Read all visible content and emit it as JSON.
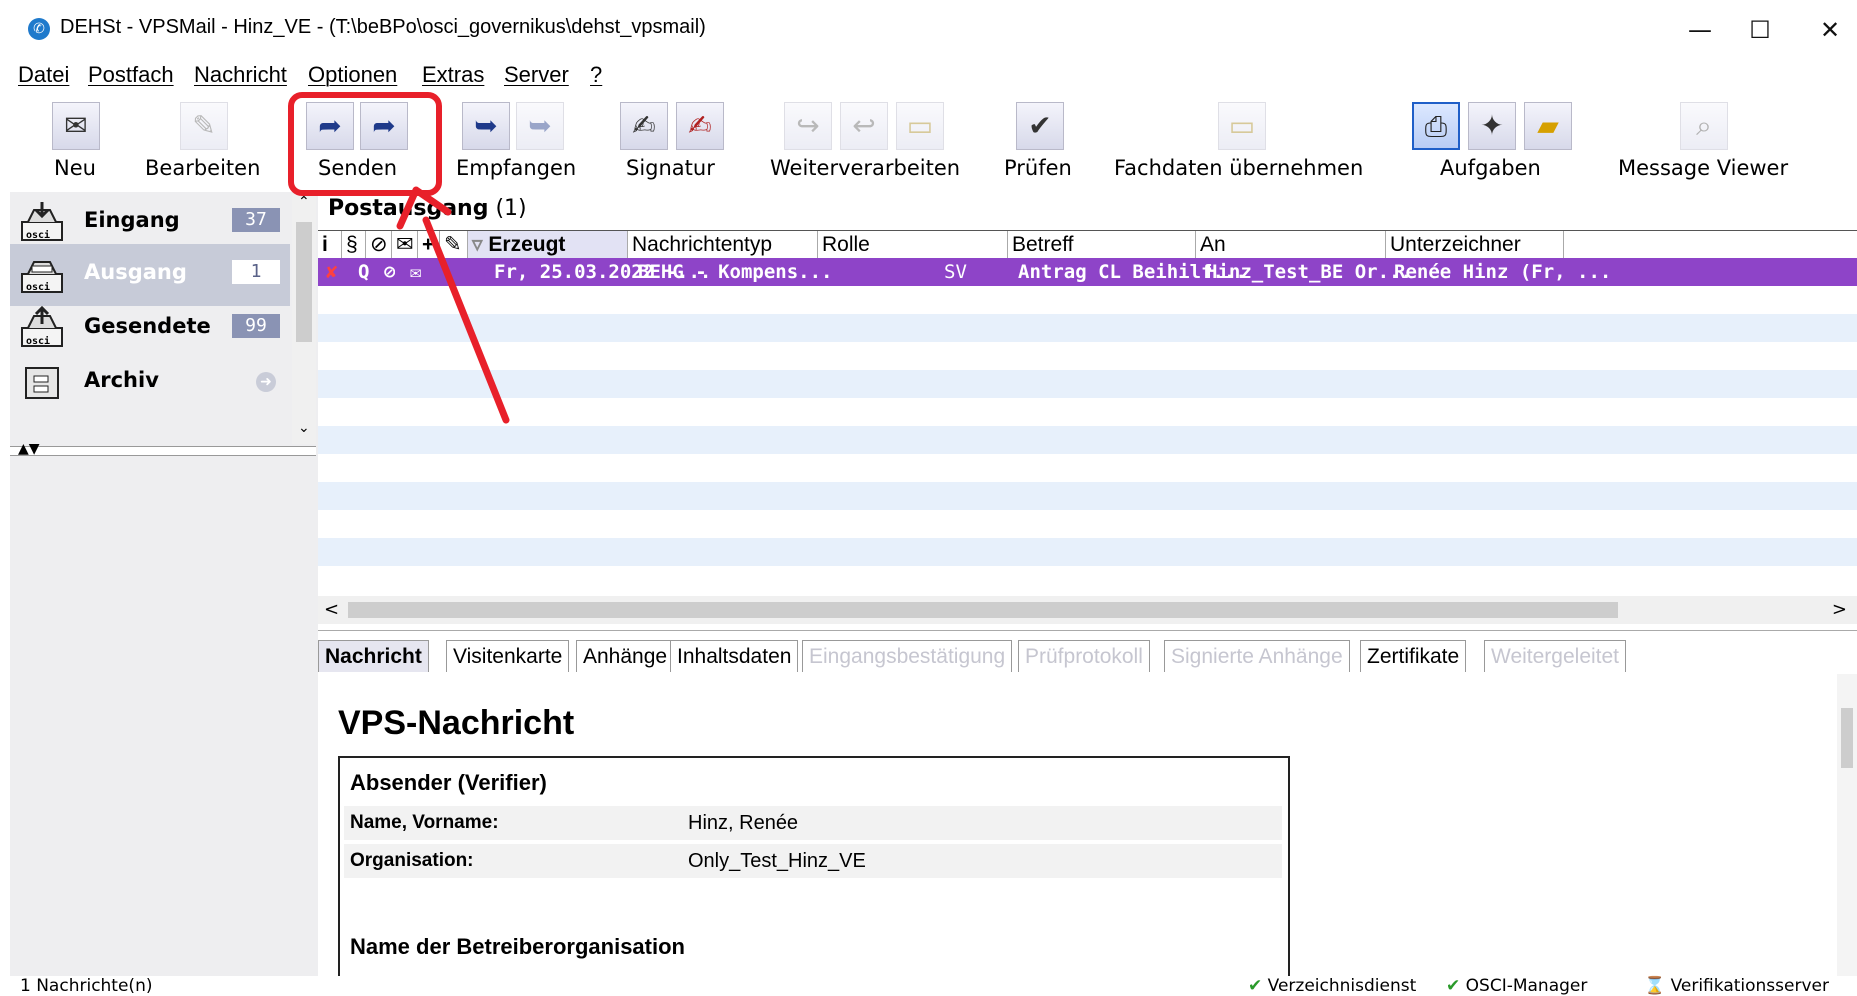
{
  "window": {
    "title": "DEHSt - VPSMail - Hinz_VE - (T:\\beBPo\\osci_governikus\\dehst_vpsmail)",
    "minimize": "—",
    "maximize": "☐",
    "close": "✕"
  },
  "menu": [
    "Datei",
    "Postfach",
    "Nachricht",
    "Optionen",
    "Extras",
    "Server",
    "?"
  ],
  "toolbar": {
    "neu": "Neu",
    "bearbeiten": "Bearbeiten",
    "senden": "Senden",
    "empfangen": "Empfangen",
    "signatur": "Signatur",
    "weiterverarbeiten": "Weiterverarbeiten",
    "pruefen": "Prüfen",
    "fachdaten": "Fachdaten übernehmen",
    "aufgaben": "Aufgaben",
    "viewer": "Message Viewer"
  },
  "sidebar": {
    "folders": [
      {
        "name": "Eingang",
        "count": "37"
      },
      {
        "name": "Ausgang",
        "count": "1"
      },
      {
        "name": "Gesendete",
        "count": "99"
      },
      {
        "name": "Archiv",
        "count": ""
      }
    ],
    "selected": "Ausgang",
    "osci": "osci"
  },
  "list": {
    "title": "Postausgang",
    "count": "(1)",
    "columns": {
      "i": "i",
      "para": "§",
      "att": "⊘",
      "env": "✉",
      "plus": "+",
      "sign": "✎",
      "sort": "▿",
      "erzeugt": "Erzeugt",
      "typ": "Nachrichtentyp",
      "rolle": "Rolle",
      "betreff": "Betreff",
      "an": "An",
      "unterzeichner": "Unterzeichner"
    },
    "rows": [
      {
        "flag": "✘",
        "q": "Q",
        "att": "⊘",
        "env": "✉",
        "erzeugt": "Fr, 25.03.2022 -...",
        "typ": "BEHG - Kompens...",
        "rolle": "SV",
        "betreff": "Antrag CL Beihilf...",
        "an": "Hinz_Test_BE Or...",
        "unterzeichner": "Renée Hinz (Fr, ..."
      }
    ]
  },
  "tabs": [
    {
      "label": "Nachricht",
      "state": "active"
    },
    {
      "label": "Visitenkarte",
      "state": "normal"
    },
    {
      "label": "Anhänge",
      "state": "normal"
    },
    {
      "label": "Inhaltsdaten",
      "state": "normal"
    },
    {
      "label": "Eingangsbestätigung",
      "state": "disabled"
    },
    {
      "label": "Prüfprotokoll",
      "state": "disabled"
    },
    {
      "label": "Signierte Anhänge",
      "state": "disabled"
    },
    {
      "label": "Zertifikate",
      "state": "normal"
    },
    {
      "label": "Weitergeleitet",
      "state": "disabled"
    }
  ],
  "message": {
    "title": "VPS-Nachricht",
    "absender_head": "Absender (Verifier)",
    "name_label": "Name, Vorname:",
    "name_value": "Hinz, Renée",
    "org_label": "Organisation:",
    "org_value": "Only_Test_Hinz_VE",
    "betreiber_head": "Name der Betreiberorganisation"
  },
  "status": {
    "left": "1 Nachrichte(n)",
    "verzeichnis": "Verzeichnisdienst",
    "osci_manager": "OSCI-Manager",
    "verifikation": "Verifikationsserver"
  },
  "colors": {
    "selected_row": "#8e44c8",
    "annotation": "#e8202a",
    "sidebar_badge": "#8a93b4"
  }
}
